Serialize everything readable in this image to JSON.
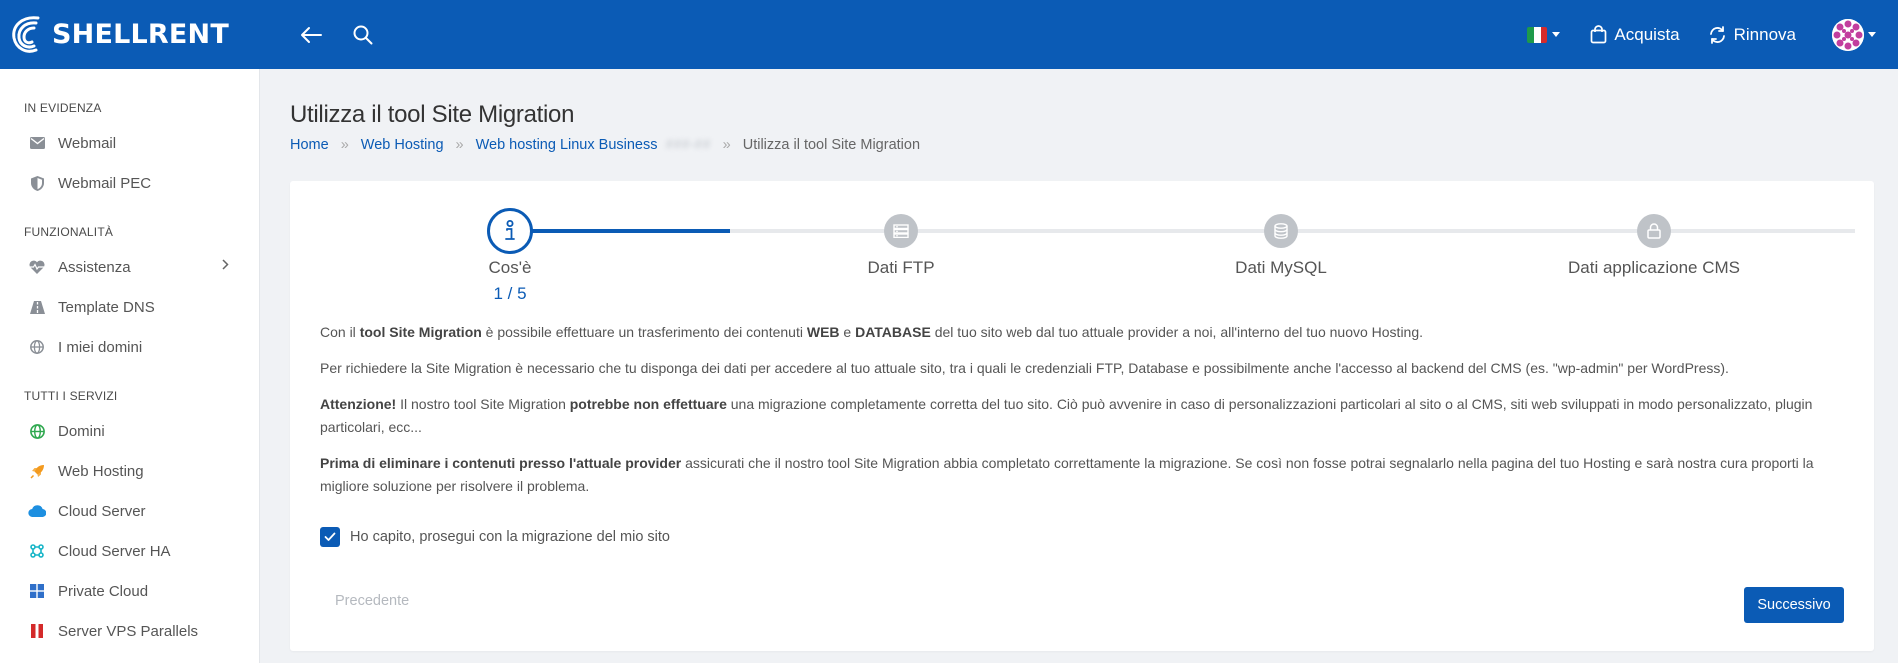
{
  "header": {
    "brand": "SHELLRENT",
    "language": "Italiano",
    "buy_label": "Acquista",
    "renew_label": "Rinnova"
  },
  "sidebar": {
    "sections": [
      {
        "title": "IN EVIDENZA",
        "items": [
          {
            "label": "Webmail",
            "icon": "mail-icon"
          },
          {
            "label": "Webmail PEC",
            "icon": "shield-icon"
          }
        ]
      },
      {
        "title": "FUNZIONALITÀ",
        "items": [
          {
            "label": "Assistenza",
            "icon": "heartbeat-icon"
          },
          {
            "label": "Template DNS",
            "icon": "road-icon"
          },
          {
            "label": "I miei domini",
            "icon": "globe-icon"
          }
        ]
      },
      {
        "title": "TUTTI I SERVIZI",
        "items": [
          {
            "label": "Domini",
            "icon": "globe-icon"
          },
          {
            "label": "Web Hosting",
            "icon": "rocket-icon"
          },
          {
            "label": "Cloud Server",
            "icon": "cloud-icon"
          },
          {
            "label": "Cloud Server HA",
            "icon": "network-icon"
          },
          {
            "label": "Private Cloud",
            "icon": "windows-icon"
          },
          {
            "label": "Server VPS Parallels",
            "icon": "parallels-icon"
          }
        ]
      }
    ]
  },
  "page": {
    "title": "Utilizza il tool Site Migration",
    "breadcrumb": {
      "home": "Home",
      "web_hosting": "Web Hosting",
      "hosting_plan": "Web hosting Linux Business",
      "hosting_plan_id": "###-##",
      "current": "Utilizza il tool Site Migration"
    }
  },
  "stepper": {
    "progress": "1 / 5",
    "steps": [
      {
        "label": "Cos'è",
        "icon": "info-icon",
        "state": "active"
      },
      {
        "label": "Dati FTP",
        "icon": "server-icon",
        "state": "pending"
      },
      {
        "label": "Dati MySQL",
        "icon": "database-icon",
        "state": "pending"
      },
      {
        "label": "Dati applicazione CMS",
        "icon": "lock-icon",
        "state": "pending"
      }
    ]
  },
  "content": {
    "p1": {
      "a": "Con il ",
      "b": "tool Site Migration",
      "c": " è possibile effettuare un trasferimento dei contenuti ",
      "d": "WEB",
      "e": " e ",
      "f": "DATABASE",
      "g": " del tuo sito web dal tuo attuale provider a noi, all'interno del tuo nuovo Hosting."
    },
    "p2": "Per richiedere la Site Migration è necessario che tu disponga dei dati per accedere al tuo attuale sito, tra i quali le credenziali FTP, Database e possibilmente anche l'accesso al backend del CMS (es. \"wp-admin\" per WordPress).",
    "p3": {
      "a": "Attenzione!",
      "b": " Il nostro tool Site Migration ",
      "c": "potrebbe non effettuare",
      "d": " una migrazione completamente corretta del tuo sito. Ciò può avvenire in caso di personalizzazioni particolari al sito o al CMS, siti web sviluppati in modo personalizzato, plugin particolari, ecc..."
    },
    "p4": {
      "a": "Prima di eliminare i contenuti presso l'attuale provider",
      "b": " assicurati che il nostro tool Site Migration abbia completato correttamente la migrazione. Se così non fosse potrai segnalarlo nella pagina del tuo Hosting e sarà nostra cura proporti la migliore soluzione per risolvere il problema."
    },
    "confirm_label": "Ho capito, prosegui con la migrazione del mio sito",
    "confirm_checked": true
  },
  "actions": {
    "prev_label": "Precedente",
    "next_label": "Successivo"
  },
  "colors": {
    "primary": "#0b5bb5",
    "background": "#f0f2f5"
  }
}
